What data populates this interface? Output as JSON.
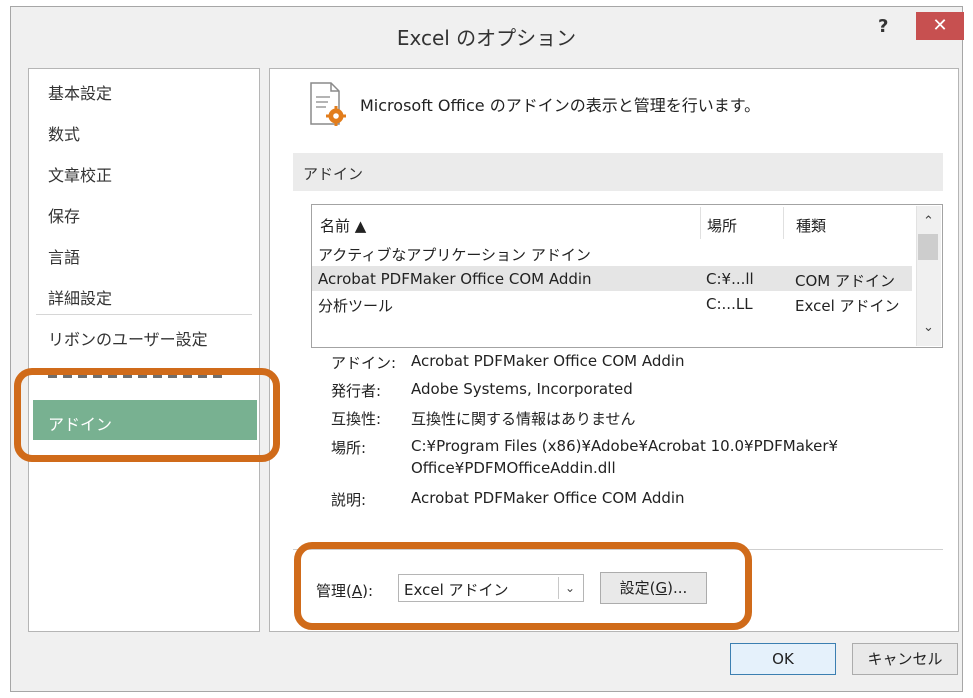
{
  "window": {
    "title": "Excel のオプション",
    "help_label": "?",
    "close_label": "✕"
  },
  "sidebar": {
    "items": [
      {
        "label": "基本設定"
      },
      {
        "label": "数式"
      },
      {
        "label": "文章校正"
      },
      {
        "label": "保存"
      },
      {
        "label": "言語"
      },
      {
        "label": "詳細設定"
      },
      {
        "label": "リボンのユーザー設定"
      },
      {
        "label": "アドイン",
        "selected": true
      }
    ]
  },
  "header": {
    "icon": "gear-document-icon",
    "text": "Microsoft Office のアドインの表示と管理を行います。"
  },
  "section": {
    "label": "アドイン"
  },
  "addins_list": {
    "columns": [
      "名前 ▲",
      "場所",
      "種類"
    ],
    "group_label": "アクティブなアプリケーション アドイン",
    "rows": [
      {
        "name": "Acrobat PDFMaker Office COM Addin",
        "location": "C:¥...ll",
        "type": "COM アドイン",
        "selected": true
      },
      {
        "name": "分析ツール",
        "location": "C:...LL",
        "type": "Excel アドイン"
      }
    ]
  },
  "details": {
    "addin_label": "アドイン:",
    "addin_value": "Acrobat PDFMaker Office COM Addin",
    "publisher_label": "発行者:",
    "publisher_value": "Adobe Systems, Incorporated",
    "compat_label": "互換性:",
    "compat_value": "互換性に関する情報はありません",
    "location_label": "場所:",
    "location_value_line1": "C:¥Program Files (x86)¥Adobe¥Acrobat 10.0¥PDFMaker¥",
    "location_value_line2": "Office¥PDFMOfficeAddin.dll",
    "desc_label": "説明:",
    "desc_value": "Acrobat PDFMaker Office COM Addin"
  },
  "manage": {
    "label_pre": "管理(",
    "label_key": "A",
    "label_post": "):",
    "select_value": "Excel アドイン",
    "go_pre": "設定(",
    "go_key": "G",
    "go_post": ")..."
  },
  "footer": {
    "ok_label": "OK",
    "cancel_label": "キャンセル"
  },
  "highlight_color": "#d06b1a",
  "selected_color": "#78b191"
}
